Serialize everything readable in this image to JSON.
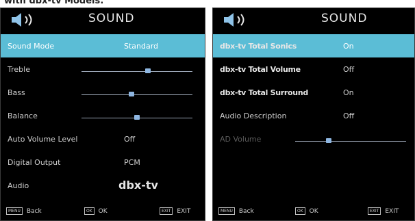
{
  "caption": "with dbx-tv Models:",
  "left_panel": {
    "title": "SOUND",
    "items": [
      {
        "label": "Sound Mode",
        "value": "Standard",
        "selected": true
      },
      {
        "label": "Treble",
        "slider": 0.6
      },
      {
        "label": "Bass",
        "slider": 0.45
      },
      {
        "label": "Balance",
        "slider": 0.5
      },
      {
        "label": "Auto Volume Level",
        "value": "Off"
      },
      {
        "label": "Digital Output",
        "value": "PCM"
      },
      {
        "label": "Audio",
        "value": "dbx-tv"
      }
    ],
    "footer": {
      "back_key": "MENU",
      "back_label": "Back",
      "ok_key": "OK",
      "ok_label": "OK",
      "exit_key": "EXIT",
      "exit_label": "EXIT"
    }
  },
  "right_panel": {
    "title": "SOUND",
    "items": [
      {
        "label": "dbx-tv Total Sonics",
        "value": "On",
        "selected": true
      },
      {
        "label": "dbx-tv Total Volume",
        "value": "Off"
      },
      {
        "label": "dbx-tv Total Surround",
        "value": "On"
      },
      {
        "label": "Audio Description",
        "value": "Off"
      },
      {
        "label": "AD Volume",
        "slider": 0.3,
        "disabled": true
      }
    ],
    "footer": {
      "back_key": "MENU",
      "back_label": "Back",
      "ok_key": "OK",
      "ok_label": "OK",
      "exit_key": "EXIT",
      "exit_label": "EXIT"
    }
  },
  "colors": {
    "highlight": "#5bbdd6",
    "slider_knob": "#8fb7e2",
    "panel_bg": "#000000"
  }
}
